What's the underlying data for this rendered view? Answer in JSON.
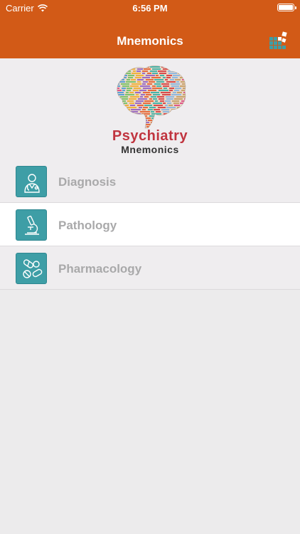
{
  "status_bar": {
    "carrier": "Carrier",
    "time": "6:56 PM"
  },
  "nav": {
    "title": "Mnemonics",
    "right_icon": "grid-menu-icon"
  },
  "logo": {
    "title": "Psychiatry",
    "subtitle": "Mnemonics",
    "image": "brain-word-cloud"
  },
  "menu": {
    "items": [
      {
        "label": "Diagnosis",
        "icon": "doctor-icon"
      },
      {
        "label": "Pathology",
        "icon": "microscope-icon",
        "selected": true
      },
      {
        "label": "Pharmacology",
        "icon": "pills-icon"
      }
    ]
  },
  "colors": {
    "header": "#d25a17",
    "icon_bg": "#3e9ea6",
    "logo_title": "#c0343f",
    "label": "#a9a9aa"
  }
}
